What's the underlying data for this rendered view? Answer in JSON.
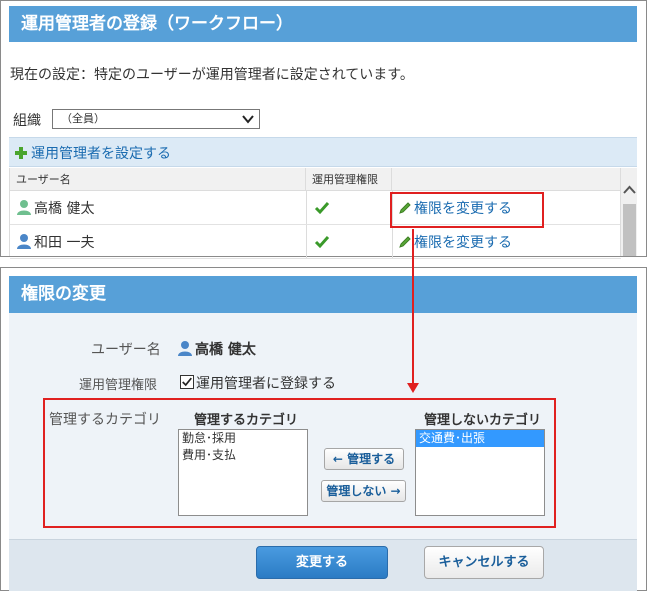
{
  "top": {
    "title": "運用管理者の登録（ワークフロー）",
    "current_setting": "現在の設定：特定のユーザーが運用管理者に設定されています。",
    "org_label": "組織",
    "org_select_value": "（全員）",
    "set_admin_link": "運用管理者を設定する",
    "table": {
      "headers": [
        "ユーザー名",
        "運用管理権限",
        ""
      ],
      "rows": [
        {
          "name": "高橋 健太",
          "link": "権限を変更する"
        },
        {
          "name": "和田 一夫",
          "link": "権限を変更する"
        }
      ]
    }
  },
  "dialog": {
    "title": "権限の変更",
    "user_label": "ユーザー名",
    "user_value": "高橋 健太",
    "perm_label": "運用管理権限",
    "perm_checkbox_label": "運用管理者に登録する",
    "category_label": "管理するカテゴリ",
    "managed_title": "管理するカテゴリ",
    "managed_items": [
      "勤怠･採用",
      "費用･支払"
    ],
    "unmanaged_title": "管理しないカテゴリ",
    "unmanaged_items": [
      "交通費･出張"
    ],
    "move_left_label": "← 管理する",
    "move_right_label": "管理しない →",
    "submit_label": "変更する",
    "cancel_label": "キャンセルする"
  },
  "colors": {
    "header_blue": "#57a0d8",
    "link_blue": "#1a6bb0",
    "highlight_red": "#e02020",
    "check_green": "#3a9a2a"
  },
  "icons": [
    "user-icon",
    "check-icon",
    "pencil-icon",
    "plus-icon",
    "chevron-down-icon",
    "chevron-up-icon"
  ]
}
